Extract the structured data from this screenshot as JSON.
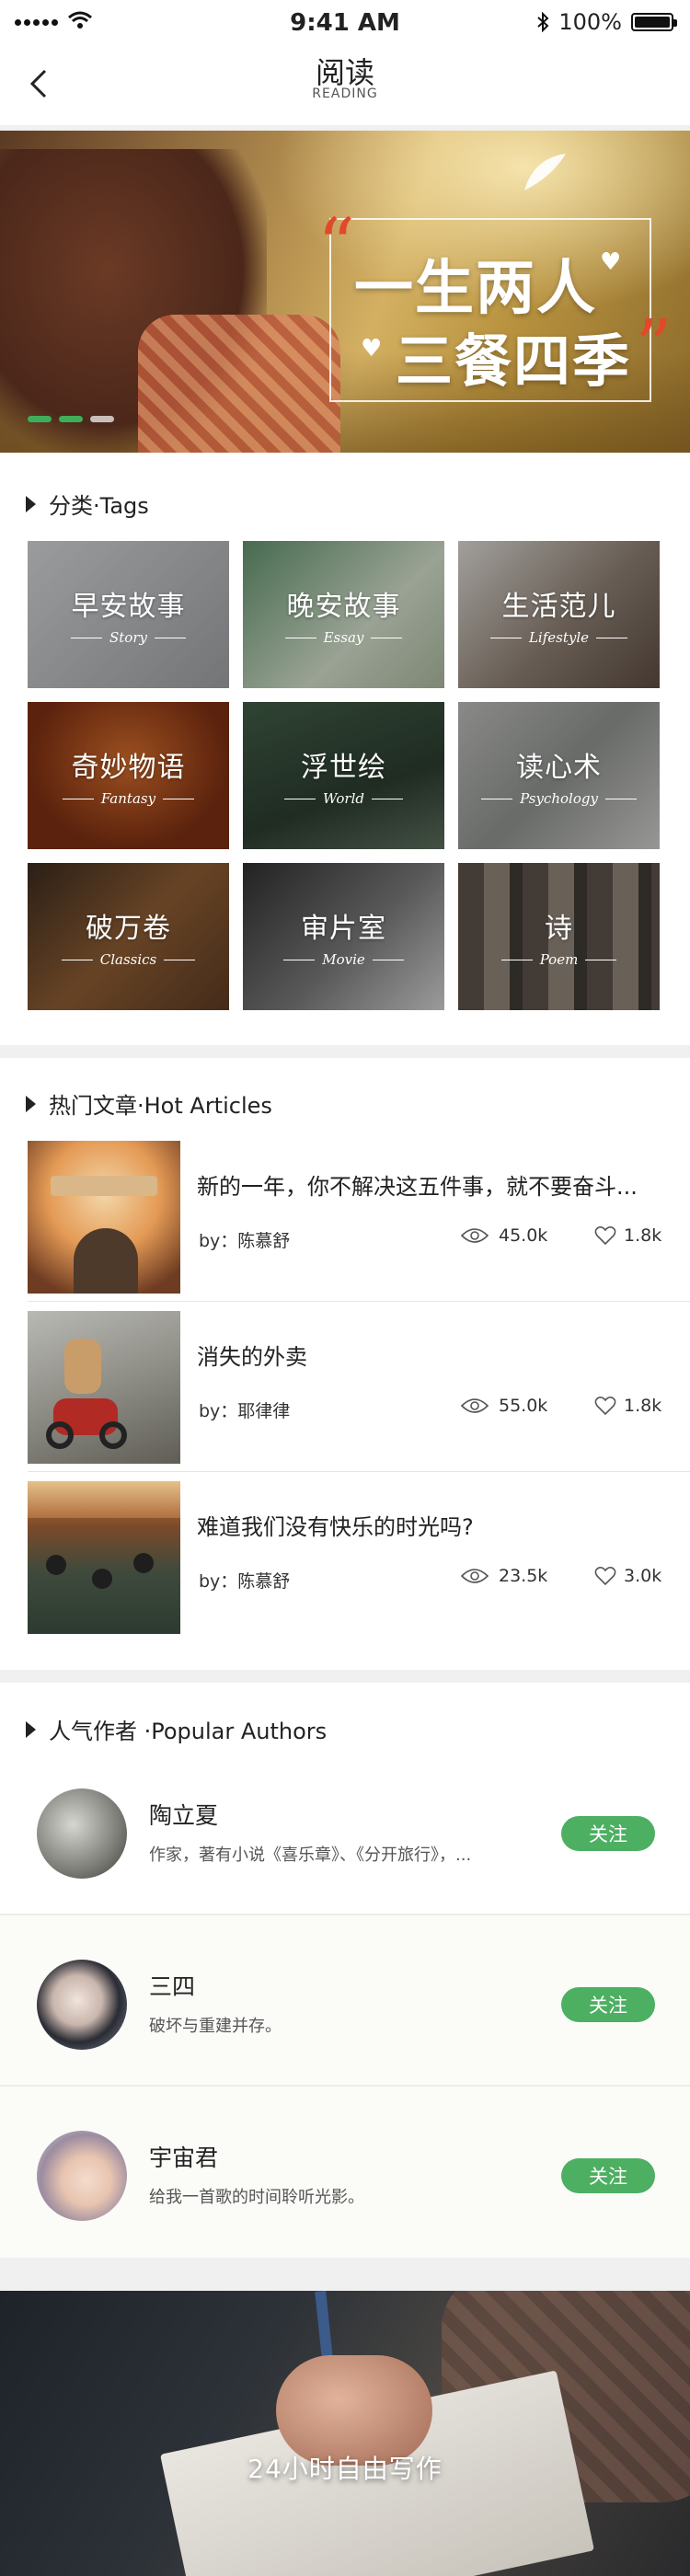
{
  "status_bar": {
    "time": "9:41 AM",
    "battery": "100%"
  },
  "nav": {
    "title": "阅读",
    "subtitle": "READING"
  },
  "banner": {
    "line1": "一生两人",
    "line2": "三餐四季",
    "quote_open": "“",
    "quote_close": "”"
  },
  "tags_section": {
    "title": "分类·Tags"
  },
  "tags": [
    {
      "cn": "早安故事",
      "en": "Story"
    },
    {
      "cn": "晚安故事",
      "en": "Essay"
    },
    {
      "cn": "生活范儿",
      "en": "Lifestyle"
    },
    {
      "cn": "奇妙物语",
      "en": "Fantasy"
    },
    {
      "cn": "浮世绘",
      "en": "World"
    },
    {
      "cn": "读心术",
      "en": "Psychology"
    },
    {
      "cn": "破万卷",
      "en": "Classics"
    },
    {
      "cn": "审片室",
      "en": "Movie"
    },
    {
      "cn": "诗",
      "en": "Poem"
    }
  ],
  "articles_section": {
    "title": "热门文章·Hot Articles"
  },
  "articles": [
    {
      "title": "新的一年，你不解决这五件事，就不要奋斗...",
      "author": "by：陈慕舒",
      "views": "45.0k",
      "likes": "1.8k"
    },
    {
      "title": "消失的外卖",
      "author": "by：耶律律",
      "views": "55.0k",
      "likes": "1.8k"
    },
    {
      "title": "难道我们没有快乐的时光吗?",
      "author": "by：陈慕舒",
      "views": "23.5k",
      "likes": "3.0k"
    }
  ],
  "authors_section": {
    "title": "人气作者 ·Popular Authors"
  },
  "authors": [
    {
      "name": "陶立夏",
      "desc": "作家，著有小说《喜乐章》、《分开旅行》，...",
      "follow": "关注"
    },
    {
      "name": "三四",
      "desc": "破坏与重建并存。",
      "follow": "关注"
    },
    {
      "name": "宇宙君",
      "desc": "给我一首歌的时间聆听光影。",
      "follow": "关注"
    }
  ],
  "writing_banner": {
    "text": "24小时自由写作"
  },
  "colors": {
    "accent_green": "#4caf62",
    "indicator_green": "#3fae5b",
    "quote_red": "#e04a2a"
  }
}
